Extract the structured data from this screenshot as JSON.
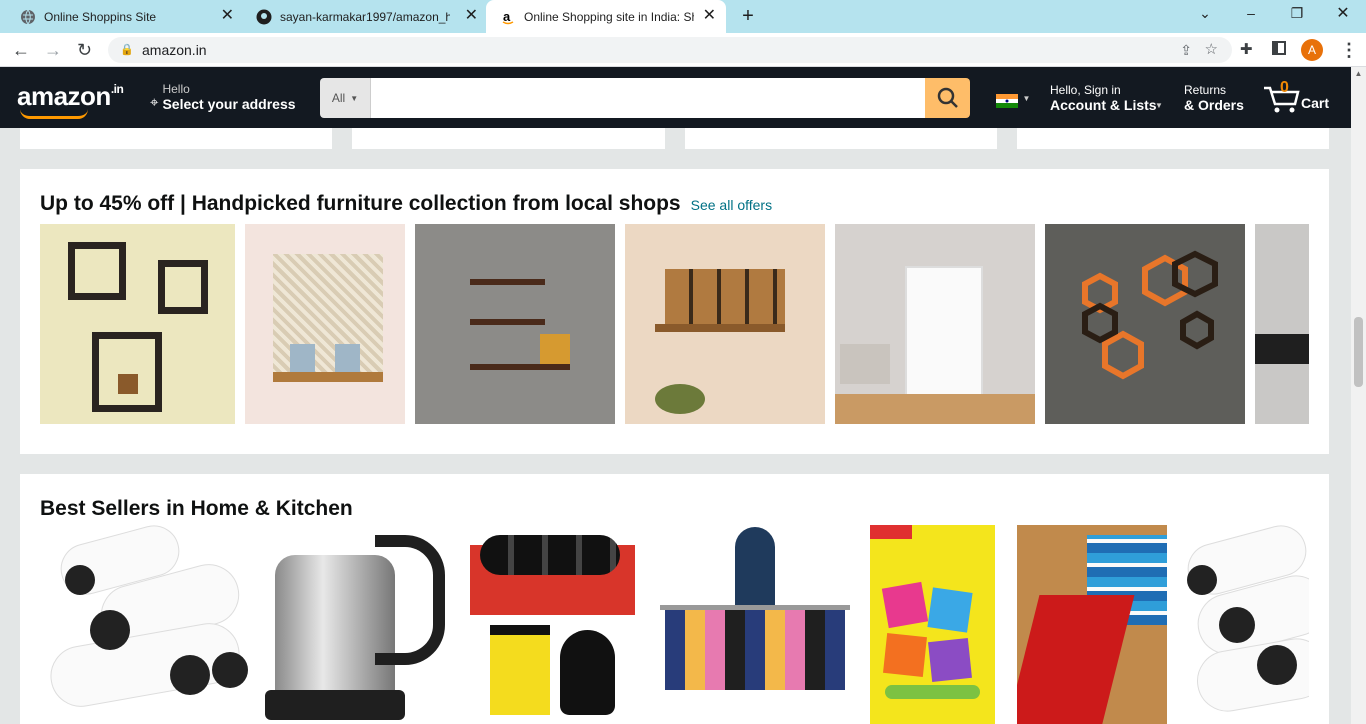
{
  "browser": {
    "tabs": [
      {
        "title": "Online Shoppins Site",
        "icon": "globe-icon"
      },
      {
        "title": "sayan-karmakar1997/amazon_ho",
        "icon": "github-icon"
      },
      {
        "title": "Online Shopping site in India: Sh",
        "icon": "amazon-icon"
      }
    ],
    "url": "amazon.in",
    "profile_initial": "A"
  },
  "header": {
    "logo": "amazon",
    "logo_suffix": ".in",
    "address_line1": "Hello",
    "address_line2": "Select your address",
    "search_category": "All",
    "search_placeholder": "",
    "account_line1": "Hello, Sign in",
    "account_line2": "Account & Lists",
    "returns_line1": "Returns",
    "returns_line2": "& Orders",
    "cart_count": "0",
    "cart_label": "Cart"
  },
  "furniture": {
    "title": "Up to 45% off | Handpicked furniture collection from local shops",
    "link": "See all offers"
  },
  "bestsellers": {
    "title": "Best Sellers in Home & Kitchen"
  },
  "colors": {
    "header_bg": "#131921",
    "search_btn": "#febd69",
    "accent": "#ff9900",
    "tab_bar": "#b5e3ee"
  }
}
